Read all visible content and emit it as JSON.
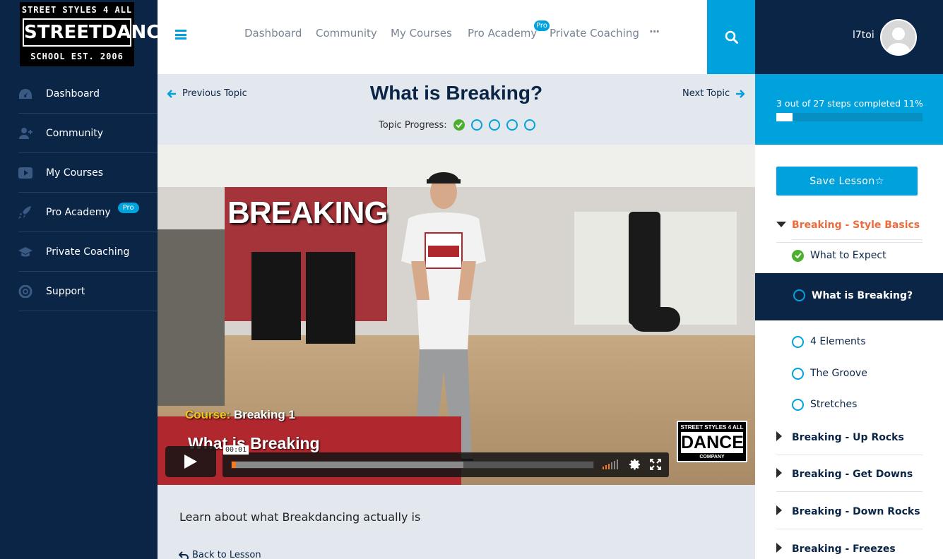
{
  "brand": {
    "logo_line1": "STREET STYLES 4 ALL",
    "logo_line2": "STREETDANCE",
    "logo_line3": "SCHOOL EST. 2006"
  },
  "sidebar": {
    "items": [
      {
        "label": "Dashboard",
        "icon": "dashboard-icon"
      },
      {
        "label": "Community",
        "icon": "users-icon"
      },
      {
        "label": "My Courses",
        "icon": "play-icon"
      },
      {
        "label": "Pro Academy",
        "icon": "rocket-icon",
        "badge": "Pro"
      },
      {
        "label": "Private Coaching",
        "icon": "graduation-cap-icon"
      },
      {
        "label": "Support",
        "icon": "lifebuoy-icon"
      }
    ]
  },
  "header": {
    "nav": [
      "Dashboard",
      "Community",
      "My Courses",
      "Pro Academy",
      "Private Coaching"
    ],
    "pro_badge": "Pro",
    "more": "···",
    "username": "l7toi"
  },
  "topic": {
    "prev_label": "Previous Topic",
    "next_label": "Next Topic",
    "title": "What is Breaking?",
    "progress_label": "Topic Progress:",
    "progress_steps": 5,
    "progress_done": 1
  },
  "video": {
    "overlay_title": "BREAKING",
    "course_prefix": "Course:",
    "course_name": "Breaking 1",
    "lesson_caption": "What is Breaking",
    "logo_top": "STREET STYLES 4 ALL",
    "logo_main": "DANCE",
    "logo_bottom": "COMPANY",
    "current_time": "00:01",
    "played_fraction": 0.01,
    "buffered_fraction": 0.64
  },
  "description": "Learn about what Breakdancing actually is",
  "back_to_lesson": "Back to Lesson",
  "course_progress": {
    "text": "3 out of 27 steps completed",
    "percent_label": "11%",
    "percent": 11
  },
  "lesson_nav": {
    "save_label": "Save Lesson☆",
    "active_section": "Breaking - Style Basics",
    "topics": [
      {
        "label": "What to Expect",
        "done": true
      },
      {
        "label": "What is Breaking?",
        "current": true
      },
      {
        "label": "4 Elements"
      },
      {
        "label": "The Groove"
      },
      {
        "label": "Stretches"
      }
    ],
    "other_sections": [
      "Breaking - Up Rocks",
      "Breaking - Get Downs",
      "Breaking - Down Rocks",
      "Breaking - Freezes"
    ]
  },
  "colors": {
    "navy": "#0b2547",
    "accent": "#00a2dd",
    "active_section": "#ed6b3c",
    "done_green": "#4caf2d"
  }
}
